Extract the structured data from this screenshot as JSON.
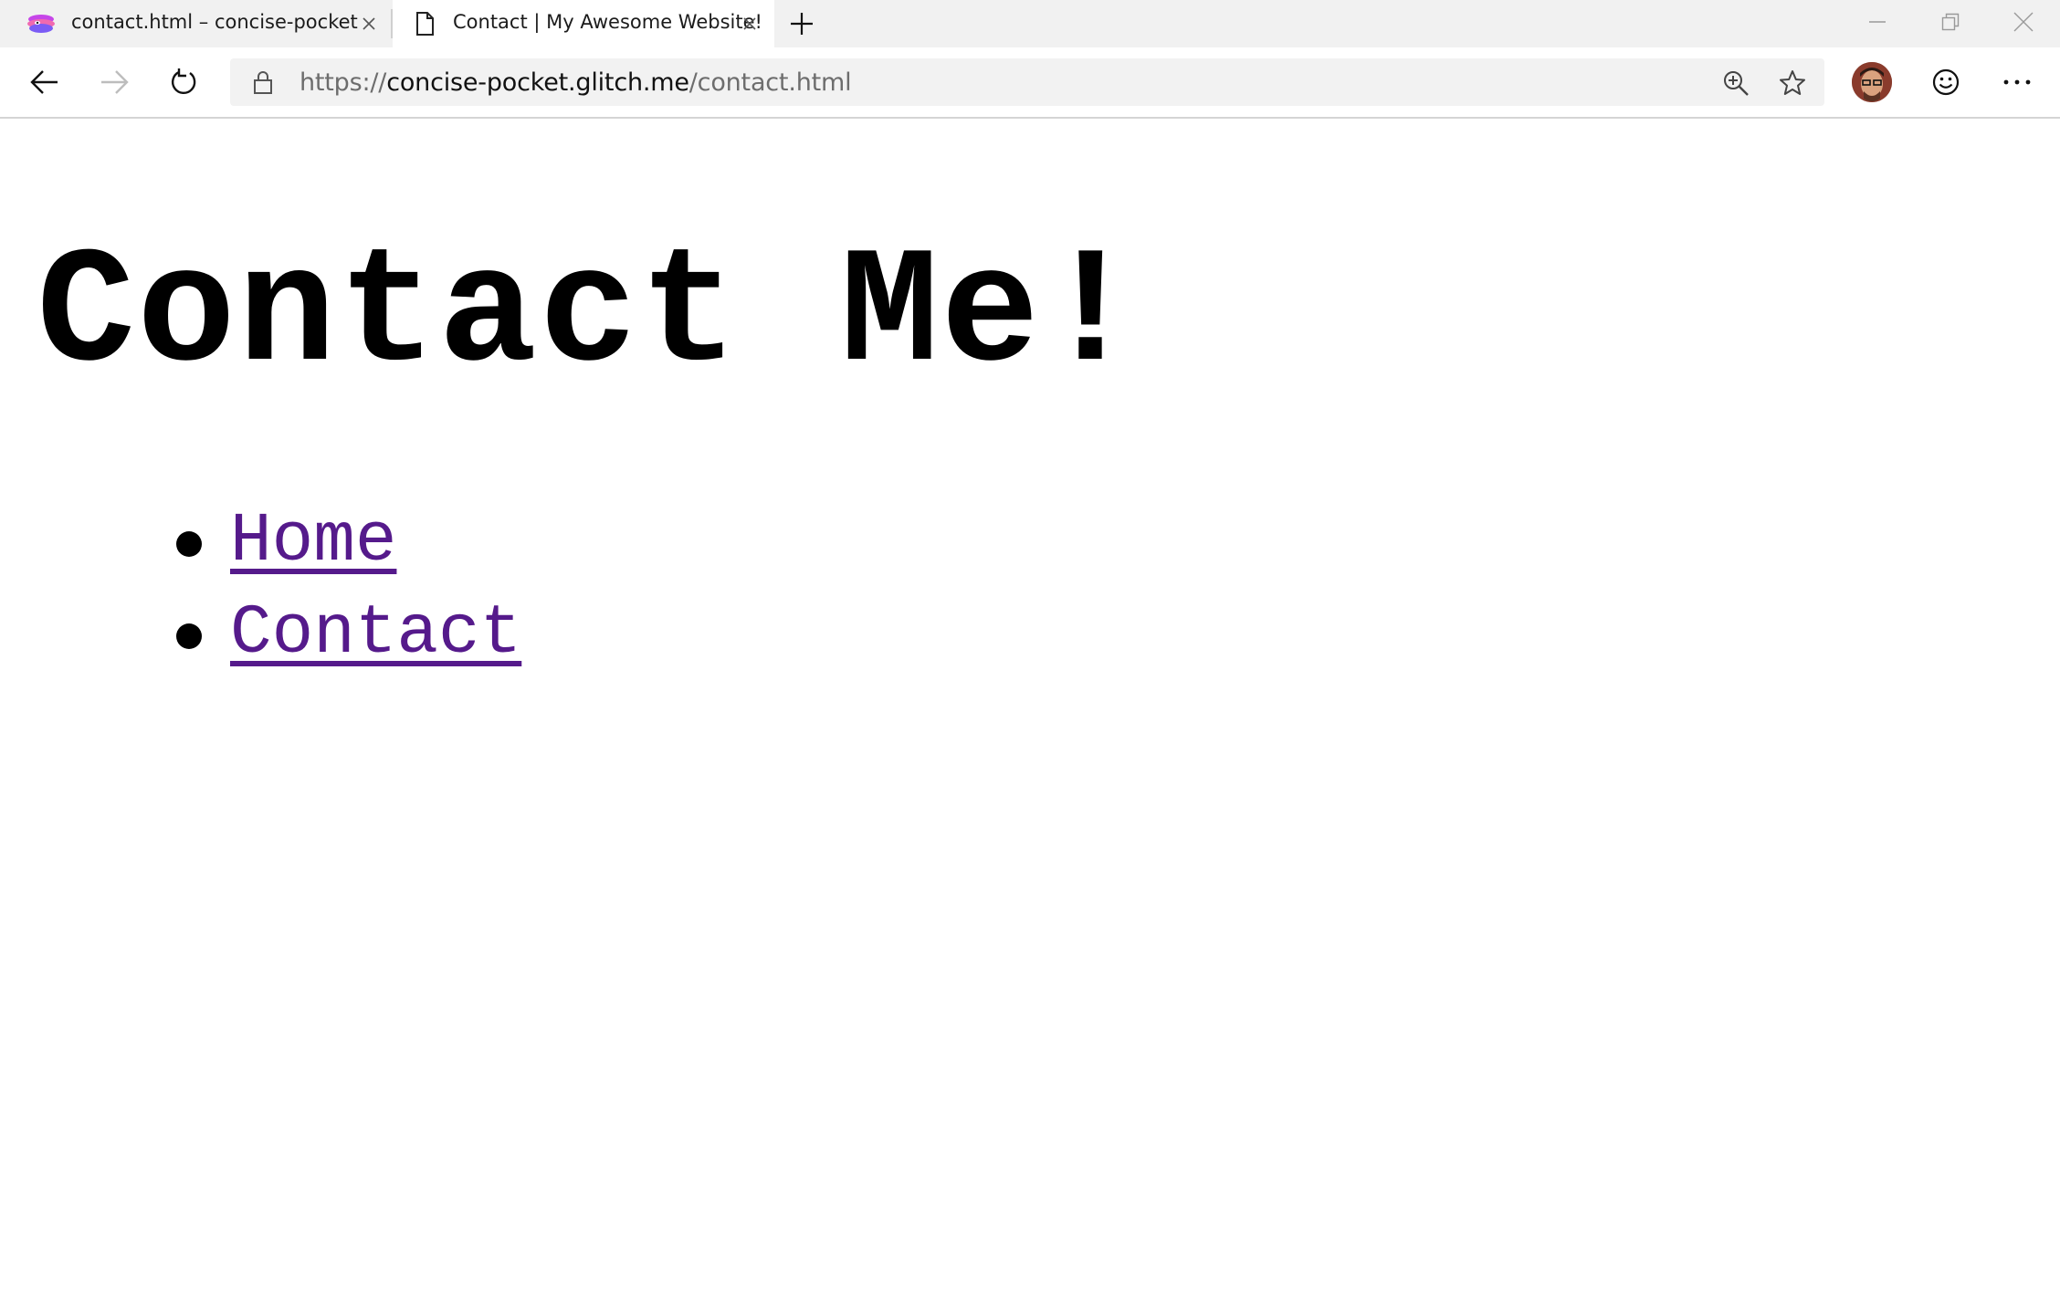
{
  "browser": {
    "tabs": [
      {
        "title": "contact.html – concise-pocket",
        "icon": "glitch-logo-icon",
        "active": false
      },
      {
        "title": "Contact | My Awesome Website!",
        "icon": "page-icon",
        "active": true
      }
    ],
    "address": {
      "scheme": "https://",
      "host": "concise-pocket.glitch.me",
      "path": "/contact.html"
    },
    "colors": {
      "tabstrip": "#f1f1f1",
      "address_bar": "#f2f2f2",
      "link_visited": "#551a8b"
    }
  },
  "page": {
    "heading": "Contact Me!",
    "nav": [
      {
        "label": "Home"
      },
      {
        "label": "Contact"
      }
    ]
  }
}
